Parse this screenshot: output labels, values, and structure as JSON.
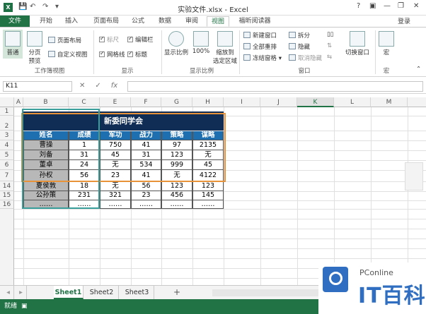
{
  "window": {
    "title": "实验文件.xlsx - Excel",
    "help": "?",
    "minimize": "—",
    "restore": "❐",
    "close": "✕"
  },
  "ribbon_tabs": [
    "文件",
    "开始",
    "插入",
    "页面布局",
    "公式",
    "数据",
    "审阅",
    "视图",
    "福昕阅读器"
  ],
  "active_tab": "视图",
  "login": "登录",
  "ribbon": {
    "normal": "普通",
    "page_break_1": "分页",
    "page_break_2": "预览",
    "page_layout": "页面布局",
    "custom_views": "自定义视图",
    "group_views": "工作簿视图",
    "ruler": "标尺",
    "formula_bar": "编辑栏",
    "gridlines": "网格线",
    "headings": "标题",
    "group_show": "显示",
    "zoom": "显示比例",
    "zoom100": "100%",
    "zoom_sel_1": "缩放到",
    "zoom_sel_2": "选定区域",
    "group_zoom": "显示比例",
    "new_window": "新建窗口",
    "arrange_all": "全部重排",
    "freeze": "冻结窗格",
    "split": "拆分",
    "hide": "隐藏",
    "unhide": "取消隐藏",
    "group_window": "窗口",
    "switch_window": "切换窗口",
    "macros": "宏",
    "group_macros": "宏"
  },
  "formula_bar": {
    "name_box": "K11",
    "cancel": "✕",
    "enter": "✓",
    "fx": "fx",
    "value": ""
  },
  "columns": [
    "A",
    "B",
    "C",
    "E",
    "F",
    "G",
    "H",
    "I",
    "J",
    "K",
    "L",
    "M"
  ],
  "selected_column": "K",
  "rows": [
    "1",
    "2",
    "3",
    "4",
    "5",
    "6",
    "7",
    "14",
    "15",
    "16"
  ],
  "table": {
    "title": "新委同学会",
    "headers": [
      "姓名",
      "成绩",
      "军功",
      "战力",
      "策略",
      "谋略"
    ],
    "data": [
      [
        "曹操",
        "1",
        "750",
        "41",
        "97",
        "2135"
      ],
      [
        "刘备",
        "31",
        "45",
        "31",
        "123",
        "无"
      ],
      [
        "董卓",
        "24",
        "无",
        "534",
        "999",
        "45"
      ],
      [
        "孙权",
        "56",
        "23",
        "41",
        "无",
        "4122"
      ],
      [
        "夏侯敦",
        "18",
        "无",
        "56",
        "123",
        "123"
      ],
      [
        "公孙策",
        "231",
        "321",
        "23",
        "456",
        "145"
      ],
      [
        "……",
        "……",
        "……",
        "……",
        "……",
        "……"
      ]
    ]
  },
  "sheets": [
    "Sheet1",
    "Sheet2",
    "Sheet3"
  ],
  "active_sheet": "Sheet1",
  "add_sheet": "+",
  "status": "就绪",
  "watermark": {
    "brand": "PConline",
    "text": "IT百科"
  }
}
